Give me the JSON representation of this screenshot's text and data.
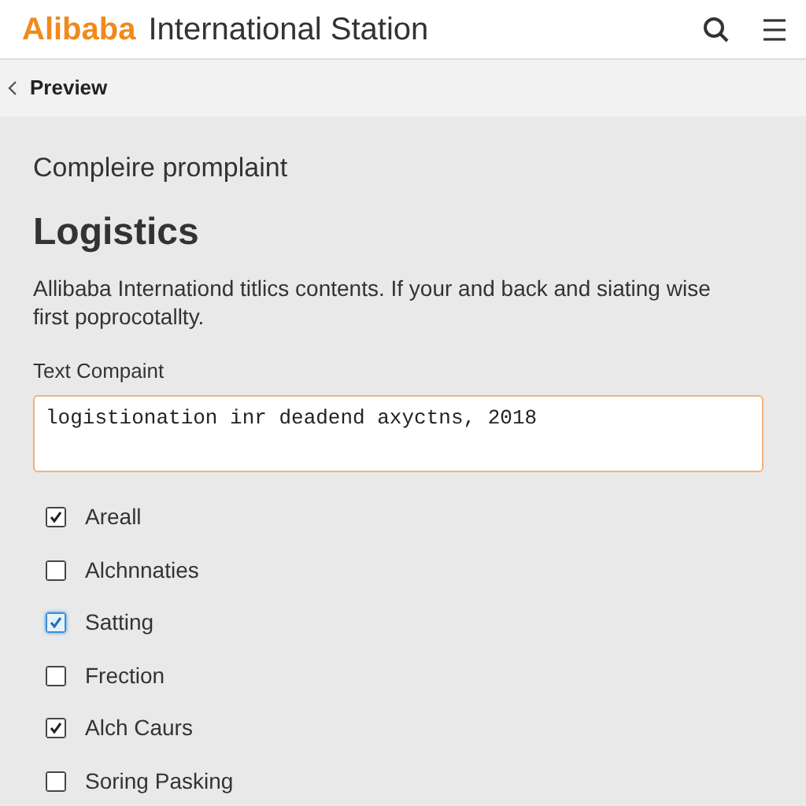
{
  "header": {
    "brand": "Alibaba",
    "title": "International Station"
  },
  "nav": {
    "back_label": "Preview"
  },
  "subtitle": "Compleire promplaint",
  "heading": "Logistics",
  "description": "Allibaba Internationd titlics contents. If your and back and siating wise first poprocotallty.",
  "field": {
    "label": "Text Compaint",
    "value": "logistionation inr deadend axyctns, 2018"
  },
  "options": [
    {
      "label": "Areall",
      "checked": true,
      "focused": false
    },
    {
      "label": "Alchnnaties",
      "checked": false,
      "focused": false
    },
    {
      "label": "Satting",
      "checked": true,
      "focused": true
    },
    {
      "label": "Frection",
      "checked": false,
      "focused": false
    },
    {
      "label": "Alch Caurs",
      "checked": true,
      "focused": false
    },
    {
      "label": "Soring Pasking",
      "checked": false,
      "focused": false
    }
  ]
}
